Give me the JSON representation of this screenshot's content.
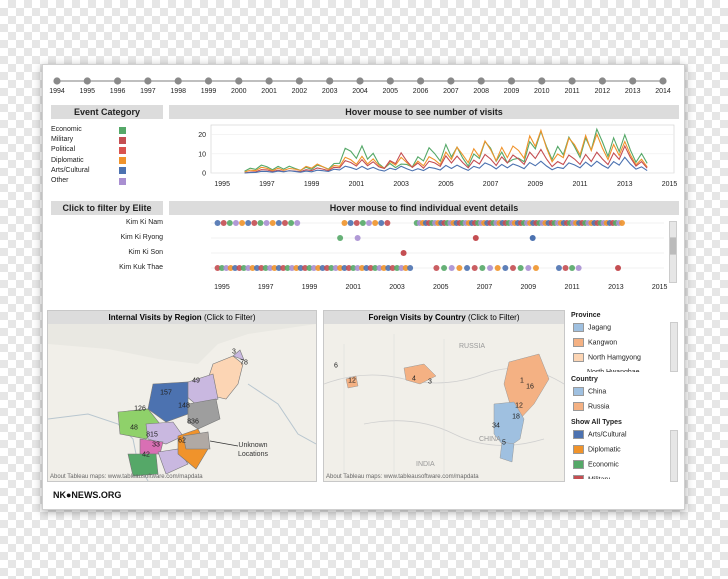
{
  "timeline": {
    "years": [
      "1994",
      "1995",
      "1996",
      "1997",
      "1998",
      "1999",
      "2000",
      "2001",
      "2002",
      "2003",
      "2004",
      "2005",
      "2006",
      "2007",
      "2008",
      "2009",
      "2010",
      "2011",
      "2012",
      "2013",
      "2014"
    ]
  },
  "event_category": {
    "title": "Event Category",
    "items": [
      {
        "label": "Economic",
        "color": "#55a868"
      },
      {
        "label": "Military",
        "color": "#c44e52"
      },
      {
        "label": "Political",
        "color": "#d9534f"
      },
      {
        "label": "Diplomatic",
        "color": "#f0932b"
      },
      {
        "label": "Arts/Cultural",
        "color": "#4c72b0"
      },
      {
        "label": "Other",
        "color": "#a98fd1"
      }
    ]
  },
  "visits_chart": {
    "title": "Hover mouse to see number of visits",
    "y_ticks": [
      "20",
      "10",
      "0"
    ],
    "x_ticks": [
      "1995",
      "1997",
      "1999",
      "2001",
      "2003",
      "2005",
      "2007",
      "2009",
      "2011",
      "2013",
      "2015"
    ]
  },
  "chart_data": {
    "type": "line",
    "x": [
      1996,
      1997,
      1998,
      1999,
      2000,
      2001,
      2002,
      2003,
      2004,
      2005,
      2006,
      2007,
      2008,
      2009,
      2010,
      2011,
      2012,
      2013,
      2014
    ],
    "ylim": [
      0,
      25
    ],
    "series": [
      {
        "color": "#55a868",
        "values": [
          2,
          4,
          3,
          3,
          5,
          17,
          6,
          4,
          10,
          15,
          8,
          16,
          6,
          20,
          14,
          18,
          20,
          17,
          8
        ]
      },
      {
        "color": "#f0932b",
        "values": [
          1,
          3,
          2,
          4,
          4,
          10,
          5,
          7,
          6,
          11,
          12,
          15,
          12,
          22,
          10,
          21,
          16,
          14,
          5
        ]
      },
      {
        "color": "#c44e52",
        "values": [
          0,
          2,
          1,
          2,
          3,
          8,
          4,
          9,
          4,
          9,
          6,
          9,
          8,
          12,
          6,
          10,
          9,
          12,
          4
        ]
      },
      {
        "color": "#4c72b0",
        "values": [
          0,
          1,
          1,
          1,
          2,
          4,
          2,
          3,
          2,
          4,
          3,
          5,
          4,
          6,
          3,
          6,
          5,
          7,
          2
        ]
      }
    ]
  },
  "elite_filter": {
    "title": "Click to filter by Elite",
    "names": [
      "Kim Ki Nam",
      "Kim Ki Ryong",
      "Kim Ki Son",
      "Kim Kuk Thae"
    ]
  },
  "event_details": {
    "title": "Hover mouse to find individual event details",
    "x_ticks": [
      "1995",
      "1997",
      "1999",
      "2001",
      "2003",
      "2005",
      "2007",
      "2009",
      "2011",
      "2013",
      "2015"
    ],
    "palette": [
      "#4c72b0",
      "#55a868",
      "#f0932b",
      "#c44e52",
      "#a98fd1"
    ]
  },
  "internal_map": {
    "title": "Internal Visits by Region",
    "filter": "(Click to Filter)",
    "labels": [
      "3",
      "78",
      "49",
      "157",
      "126",
      "148",
      "48",
      "815",
      "836",
      "33",
      "62",
      "42"
    ],
    "callout": [
      "Unknown",
      "Locations"
    ],
    "attribution": "About Tableau maps: www.tableausoftware.com/mapdata"
  },
  "foreign_map": {
    "title": "Foreign Visits by Country",
    "filter": "(Click to Filter)",
    "country_names": [
      "RUSSIA",
      "CHINA",
      "INDIA"
    ],
    "labels": [
      "6",
      "12",
      "4",
      "3",
      "1",
      "16",
      "12",
      "18",
      "34",
      "5"
    ],
    "attribution": "About Tableau maps: www.tableausoftware.com/mapdata"
  },
  "legend": {
    "province_title": "Province",
    "provinces": [
      {
        "label": "Jagang",
        "color": "#9fc0e0"
      },
      {
        "label": "Kangwon",
        "color": "#f4b183"
      },
      {
        "label": "North Hamgyong",
        "color": "#fcd5b4"
      },
      {
        "label": "North Hwanghae",
        "color": "#c9b8e0"
      }
    ],
    "country_title": "Country",
    "countries": [
      {
        "label": "China",
        "color": "#9fc0e0"
      },
      {
        "label": "Russia",
        "color": "#f4b183"
      }
    ],
    "types_title": "Show All Types",
    "types": [
      {
        "label": "Arts/Cultural",
        "color": "#4c72b0"
      },
      {
        "label": "Diplomatic",
        "color": "#f0932b"
      },
      {
        "label": "Economic",
        "color": "#55a868"
      },
      {
        "label": "Military",
        "color": "#c44e52"
      }
    ]
  },
  "brand": {
    "logo_text": "NK●NEWS.ORG"
  }
}
